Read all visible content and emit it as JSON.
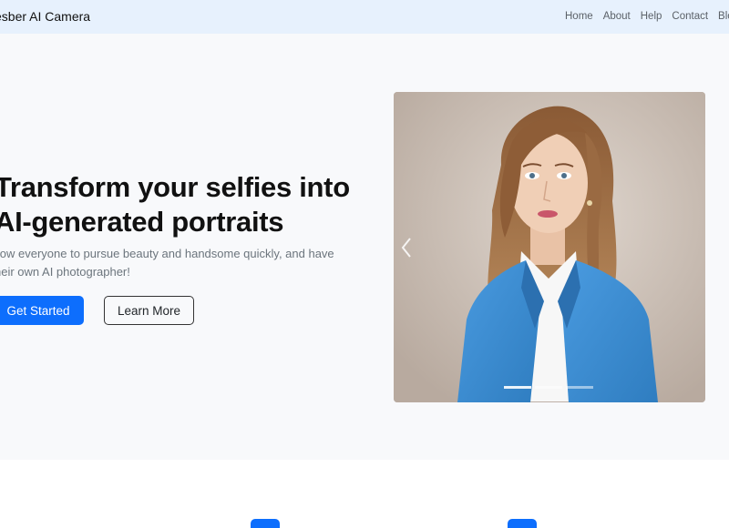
{
  "navbar": {
    "brand": "esber AI Camera",
    "links": [
      "Home",
      "About",
      "Help",
      "Contact",
      "Blog"
    ]
  },
  "hero": {
    "title_line1": "Transform your selfies into",
    "title_line2": "AI-generated portraits",
    "subtitle_line1": "llow everyone to pursue beauty and handsome quickly, and have",
    "subtitle_line2": "heir own AI photographer!",
    "primary_button": "Get Started",
    "secondary_button": "Learn More"
  },
  "carousel": {
    "slide_count": 3,
    "active_index": 0,
    "prev_icon": "chevron-left-icon"
  },
  "colors": {
    "navbar_bg": "#e7f1fd",
    "hero_bg": "#f8f9fb",
    "primary": "#0d6efd",
    "blazer": "#3d8fd1"
  }
}
